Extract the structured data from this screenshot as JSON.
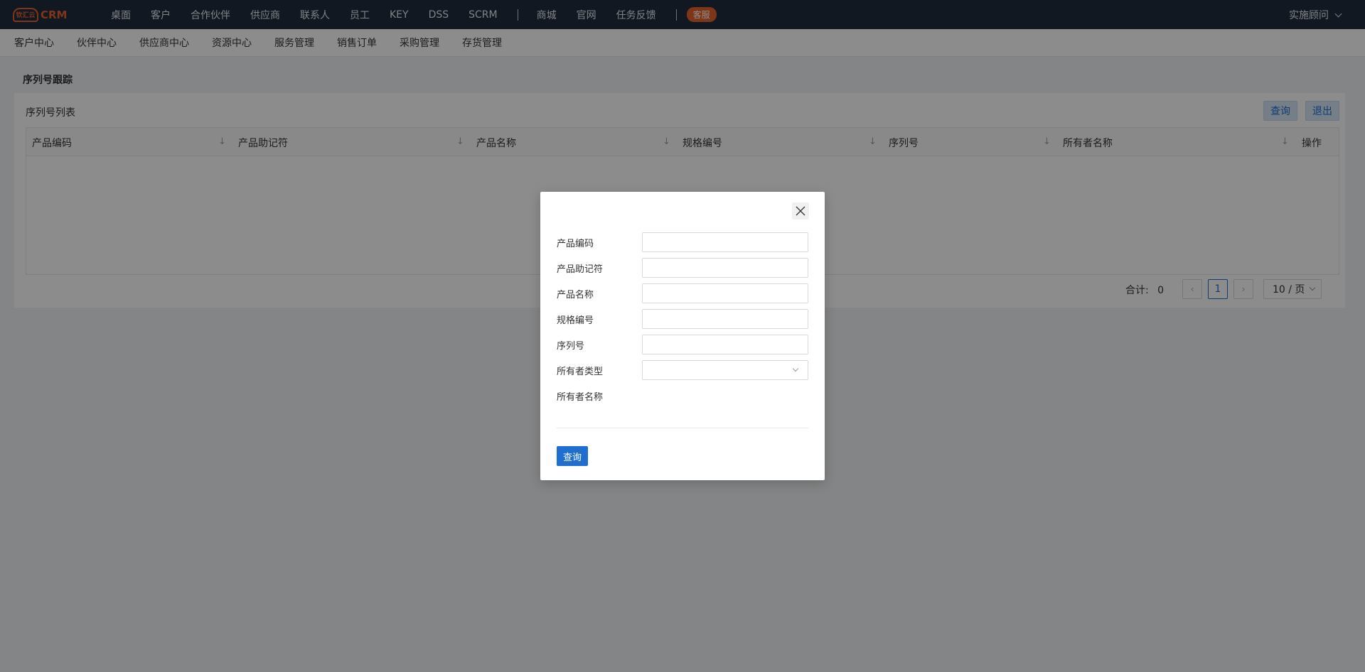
{
  "topnav": {
    "logo_mark": "钦汇云",
    "logo_text": "CRM",
    "items": [
      "桌面",
      "客户",
      "合作伙伴",
      "供应商",
      "联系人",
      "员工",
      "KEY",
      "DSS",
      "SCRM"
    ],
    "items2": [
      "商城",
      "官网",
      "任务反馈"
    ],
    "badge": "客服",
    "user": "实施顾问"
  },
  "subnav": {
    "items": [
      "客户中心",
      "伙伴中心",
      "供应商中心",
      "资源中心",
      "服务管理",
      "销售订单",
      "采购管理",
      "存货管理"
    ]
  },
  "page": {
    "title": "序列号跟踪",
    "panel_title": "序列号列表",
    "query_label": "查询",
    "exit_label": "退出",
    "columns": [
      "产品编码",
      "产品助记符",
      "产品名称",
      "规格编号",
      "序列号",
      "所有者名称",
      "操作"
    ]
  },
  "pager": {
    "total_label": "合计:",
    "total_value": "0",
    "prev": "‹",
    "current": "1",
    "next": "›",
    "page_size": "10 / 页"
  },
  "modal": {
    "fields": [
      {
        "label": "产品编码",
        "value": ""
      },
      {
        "label": "产品助记符",
        "value": ""
      },
      {
        "label": "产品名称",
        "value": ""
      },
      {
        "label": "规格编号",
        "value": ""
      },
      {
        "label": "序列号",
        "value": ""
      }
    ],
    "owner_type_label": "所有者类型",
    "owner_type_value": "",
    "owner_name_label": "所有者名称",
    "submit_label": "查询"
  }
}
